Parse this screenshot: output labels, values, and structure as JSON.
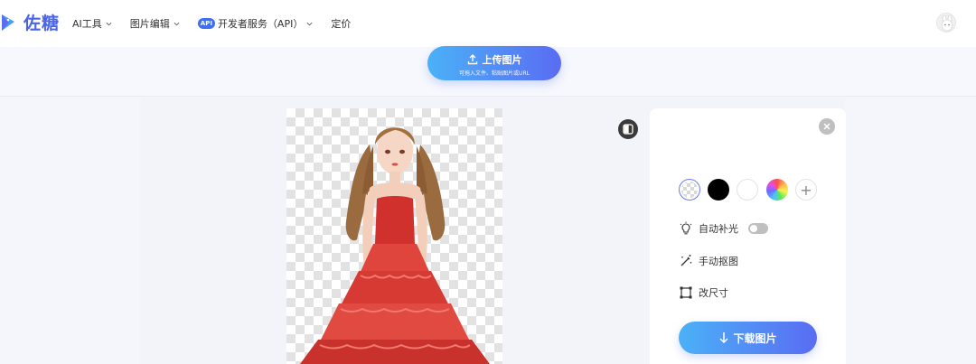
{
  "brand": {
    "name": "佐糖",
    "color": "#4a63e7"
  },
  "nav": {
    "items": [
      {
        "label": "AI工具",
        "dropdown": true
      },
      {
        "label": "图片编辑",
        "dropdown": true
      },
      {
        "badge": "API",
        "label": "开发者服务（API）",
        "dropdown": true
      },
      {
        "label": "定价",
        "dropdown": false
      }
    ]
  },
  "upload": {
    "label": "上传图片",
    "hint": "可拖入文件、粘贴图片或URL"
  },
  "panel": {
    "backgrounds": [
      {
        "name": "transparent",
        "selected": true
      },
      {
        "name": "black",
        "color": "#000000"
      },
      {
        "name": "white",
        "color": "#ffffff"
      },
      {
        "name": "custom-color"
      },
      {
        "name": "add",
        "glyph": "+"
      }
    ],
    "auto_light_label": "自动补光",
    "auto_light_on": false,
    "manual_cutout_label": "手动抠图",
    "resize_label": "改尺寸",
    "download_label": "下载图片"
  },
  "accent": "#5a6cf3",
  "accent_light": "#4bb1f7"
}
